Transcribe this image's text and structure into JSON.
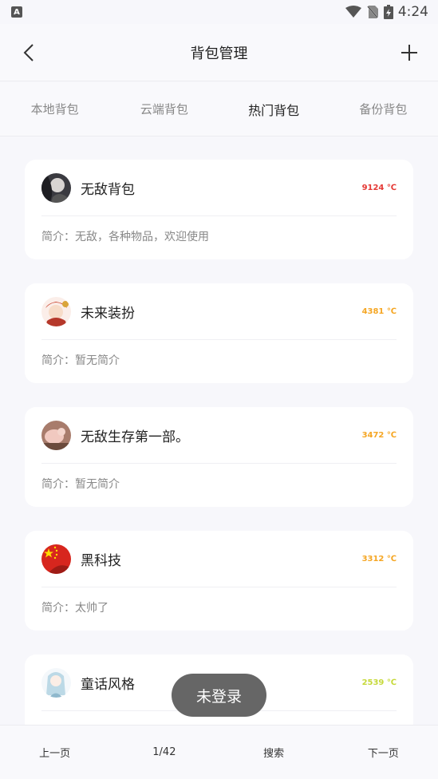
{
  "status_bar": {
    "notification_letter": "A",
    "time": "4:24"
  },
  "header": {
    "title": "背包管理"
  },
  "tabs": [
    {
      "label": "本地背包",
      "active": false
    },
    {
      "label": "云端背包",
      "active": false
    },
    {
      "label": "热门背包",
      "active": true
    },
    {
      "label": "备份背包",
      "active": false
    }
  ],
  "cards": [
    {
      "name": "无敌背包",
      "heat": "9124 ℃",
      "heat_color": "#e53935",
      "desc": "简介：无敌，各种物品，欢迎使用"
    },
    {
      "name": "未来装扮",
      "heat": "4381 ℃",
      "heat_color": "#f5a623",
      "desc": "简介：暂无简介"
    },
    {
      "name": "无敌生存第一部。",
      "heat": "3472 ℃",
      "heat_color": "#f5a623",
      "desc": "简介：暂无简介"
    },
    {
      "name": "黑科技",
      "heat": "3312 ℃",
      "heat_color": "#f5a623",
      "desc": "简介：太帅了"
    },
    {
      "name": "童话风格",
      "heat": "2539 ℃",
      "heat_color": "#c6d93a",
      "desc": ""
    }
  ],
  "bottom_bar": {
    "prev": "上一页",
    "page": "1/42",
    "search": "搜索",
    "next": "下一页"
  },
  "toast": "未登录"
}
